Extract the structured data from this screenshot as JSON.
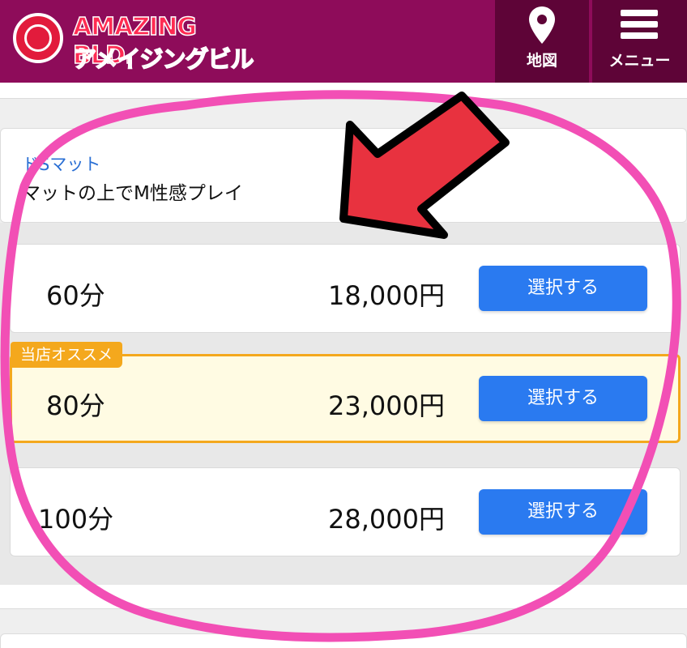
{
  "header": {
    "logo_en": "AMAZING BLD.",
    "logo_ja": "アメイジングビル",
    "map_label": "地図",
    "menu_label": "メニュー",
    "map_icon": "map-pin-icon",
    "menu_icon": "hamburger-menu-icon",
    "bg_color": "#8e0c5a"
  },
  "course": {
    "name": "ドSマット",
    "description": "マットの上でM性感プレイ"
  },
  "price_rows": [
    {
      "minutes": "60分",
      "price": "18,000円",
      "button": "選択する"
    },
    {
      "minutes": "80分",
      "price": "23,000円",
      "button": "選択する",
      "badge": "当店オススメ"
    },
    {
      "minutes": "100分",
      "price": "28,000円",
      "button": "選択する"
    }
  ],
  "colors": {
    "accent_button": "#2a7af0",
    "recommend_border": "#f4a81d",
    "annotation_circle": "#f24fb5",
    "annotation_arrow": "#e8323f"
  }
}
